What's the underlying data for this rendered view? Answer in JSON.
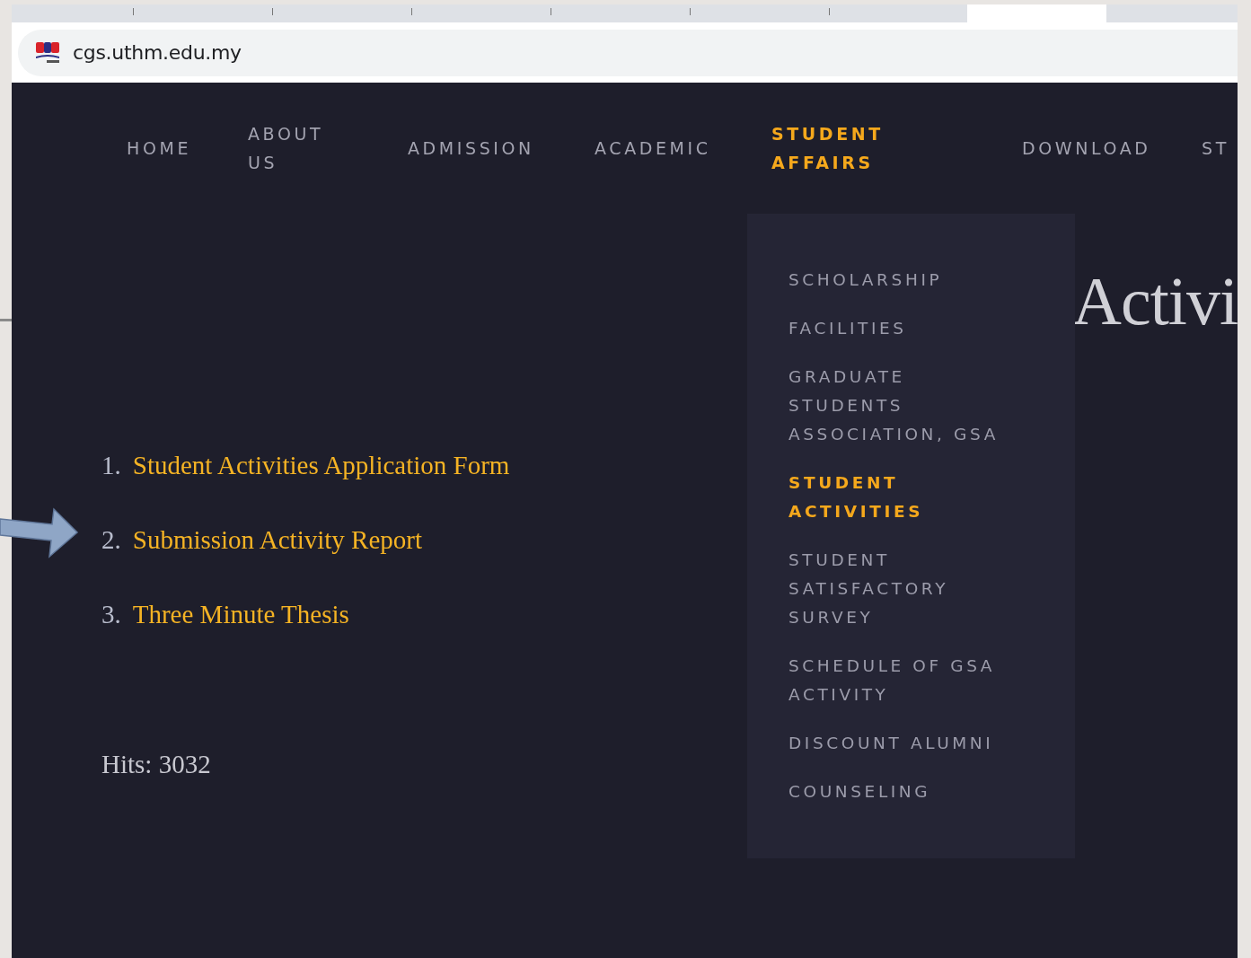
{
  "browser": {
    "url": "cgs.uthm.edu.my"
  },
  "nav": [
    {
      "label": "HOME",
      "selected": false
    },
    {
      "label": "ABOUT US",
      "selected": false
    },
    {
      "label": "ADMISSION",
      "selected": false
    },
    {
      "label": "ACADEMIC",
      "selected": false
    },
    {
      "label": "STUDENT AFFAIRS",
      "selected": true
    },
    {
      "label": "DOWNLOAD",
      "selected": false
    },
    {
      "label": "ST",
      "selected": false
    }
  ],
  "dropdown": [
    {
      "label": "SCHOLARSHIP",
      "selected": false
    },
    {
      "label": "FACILITIES",
      "selected": false
    },
    {
      "label": "GRADUATE STUDENTS ASSOCIATION, GSA",
      "selected": false
    },
    {
      "label": "STUDENT ACTIVITIES",
      "selected": true
    },
    {
      "label": "STUDENT SATISFACTORY SURVEY",
      "selected": false
    },
    {
      "label": "SCHEDULE OF GSA ACTIVITY",
      "selected": false
    },
    {
      "label": "DISCOUNT ALUMNI",
      "selected": false
    },
    {
      "label": "COUNSELING",
      "selected": false
    }
  ],
  "heading": "Activi",
  "links": [
    {
      "number": "1.",
      "label": "Student Activities Application Form"
    },
    {
      "number": "2.",
      "label": "Submission Activity Report"
    },
    {
      "number": "3.",
      "label": "Three Minute Thesis"
    }
  ],
  "hits": "Hits: 3032"
}
